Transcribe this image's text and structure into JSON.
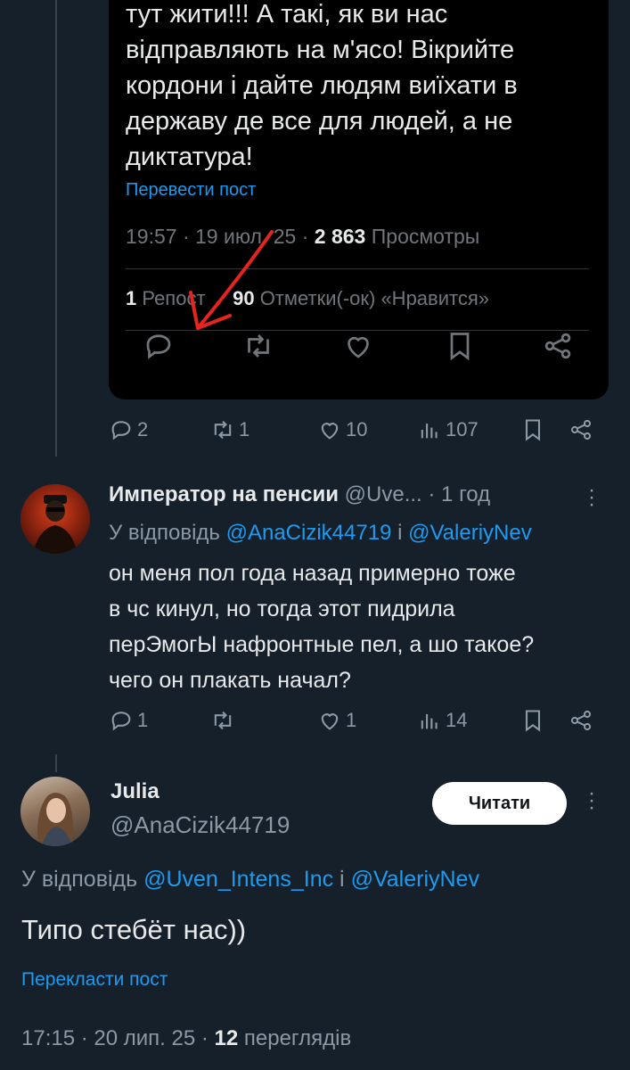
{
  "quoted_post": {
    "text_lines": [
      "тут жити!!! А такі, як ви нас",
      "відправляють на м'ясо! Вікрийте",
      "кордони і дайте людям виїхати в",
      "державу де все для людей, а не",
      "диктатура!"
    ],
    "translate_label": "Перевести пост",
    "time": "19:57 · 19 июл. 25 · ",
    "views_count": "2 863",
    "views_label": " Просмотры",
    "reposts_count": "1",
    "reposts_label": " Репост",
    "likes_count": "90",
    "likes_label": " Отметки(-ок) «Нравится»"
  },
  "parent_actions": {
    "replies": "2",
    "reposts": "1",
    "likes": "10",
    "views": "107"
  },
  "reply1": {
    "name": "Император на пенсии",
    "handle": " @Uve...",
    "time": " · 1 год",
    "reply_prefix": "У відповідь ",
    "mention1": "@AnaCizik44719",
    "mention_join": " і ",
    "mention2": "@ValeriyNev",
    "text_lines": [
      "он меня пол года назад примерно тоже",
      "в чс кинул, но тогда этот пидрила",
      "перЭмогЫ нафронтные пел, а шо такое?",
      "чего он плакать начал?"
    ],
    "actions": {
      "replies": "1",
      "reposts": "",
      "likes": "1",
      "views": "14"
    }
  },
  "reply2": {
    "name": "Julia",
    "handle": "@AnaCizik44719",
    "follow_label": "Читати",
    "reply_prefix": "У відповідь ",
    "mention1": "@Uven_Intens_Inc",
    "mention_join": " і ",
    "mention2": "@ValeriyNev",
    "text": "Типо стебёт нас))",
    "translate_label": "Перекласти пост",
    "time": "17:15 · 20 лип. 25 · ",
    "views_count": "12",
    "views_label": " переглядів"
  },
  "colors": {
    "background": "#15202b",
    "accent": "#1d9bf0",
    "annotation_arrow": "#e5241f"
  }
}
